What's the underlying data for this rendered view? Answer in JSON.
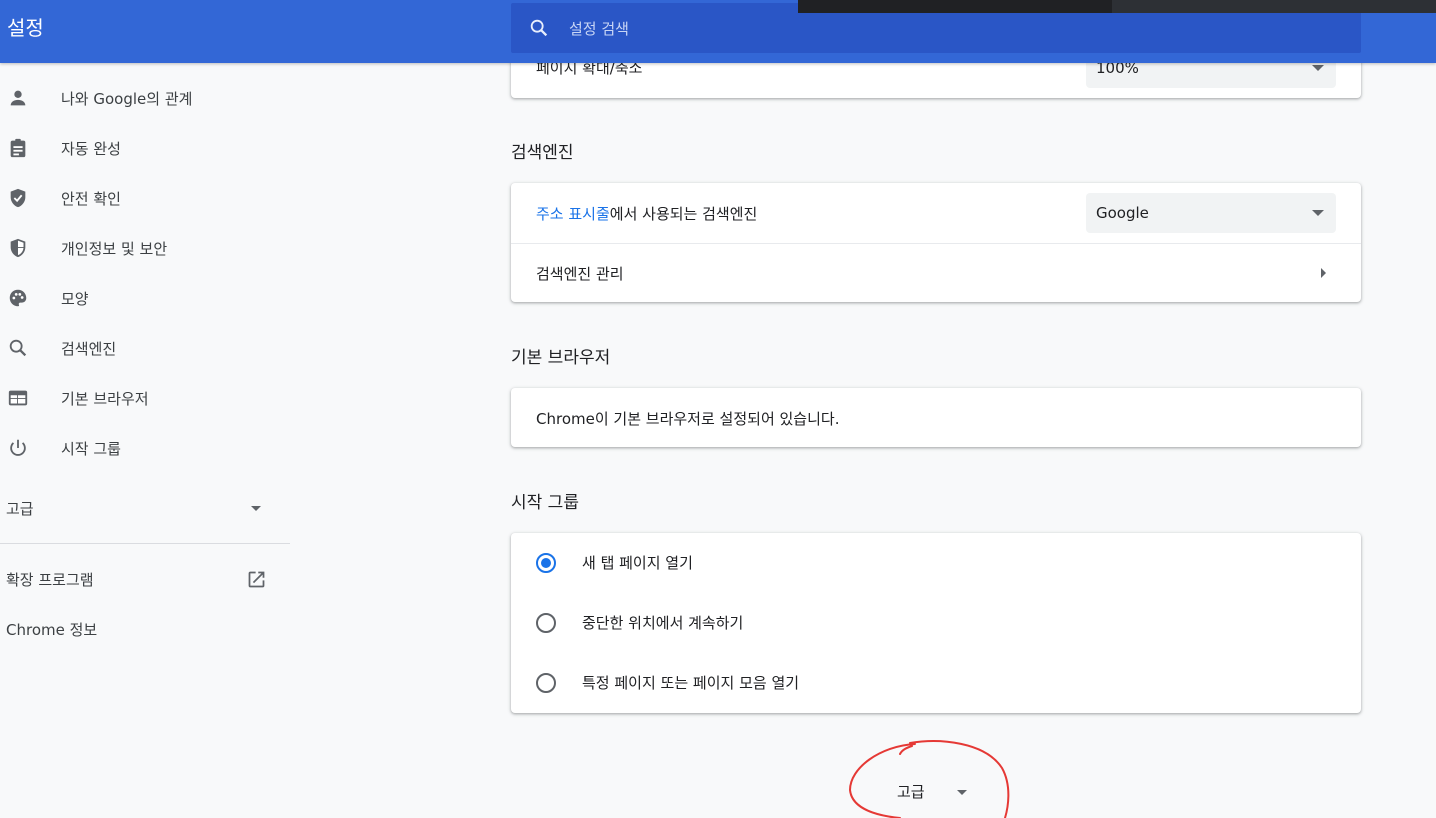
{
  "header": {
    "title": "설정",
    "search_placeholder": "설정 검색"
  },
  "sidebar": {
    "items": [
      {
        "label": "나와 Google의 관계",
        "icon": "person-icon"
      },
      {
        "label": "자동 완성",
        "icon": "clipboard-icon"
      },
      {
        "label": "안전 확인",
        "icon": "shield-check-icon"
      },
      {
        "label": "개인정보 및 보안",
        "icon": "shield-half-icon"
      },
      {
        "label": "모양",
        "icon": "palette-icon"
      },
      {
        "label": "검색엔진",
        "icon": "search-icon"
      },
      {
        "label": "기본 브라우저",
        "icon": "browser-window-icon"
      },
      {
        "label": "시작 그룹",
        "icon": "power-icon"
      }
    ],
    "advanced": "고급",
    "extensions": "확장 프로그램",
    "about": "Chrome 정보"
  },
  "appearance": {
    "zoom_label": "페이지 확대/축소",
    "zoom_value": "100%"
  },
  "search_engine": {
    "title": "검색엔진",
    "address_bar_link": "주소 표시줄",
    "address_bar_suffix": "에서 사용되는 검색엔진",
    "engine_value": "Google",
    "manage_label": "검색엔진 관리"
  },
  "default_browser": {
    "title": "기본 브라우저",
    "status": "Chrome이 기본 브라우저로 설정되어 있습니다."
  },
  "startup": {
    "title": "시작 그룹",
    "options": [
      {
        "label": "새 탭 페이지 열기",
        "selected": true
      },
      {
        "label": "중단한 위치에서 계속하기",
        "selected": false
      },
      {
        "label": "특정 페이지 또는 페이지 모음 열기",
        "selected": false
      }
    ]
  },
  "advanced_button": "고급",
  "colors": {
    "header_bg": "#3367d6",
    "accent": "#1a73e8",
    "annotation": "#e53935"
  }
}
